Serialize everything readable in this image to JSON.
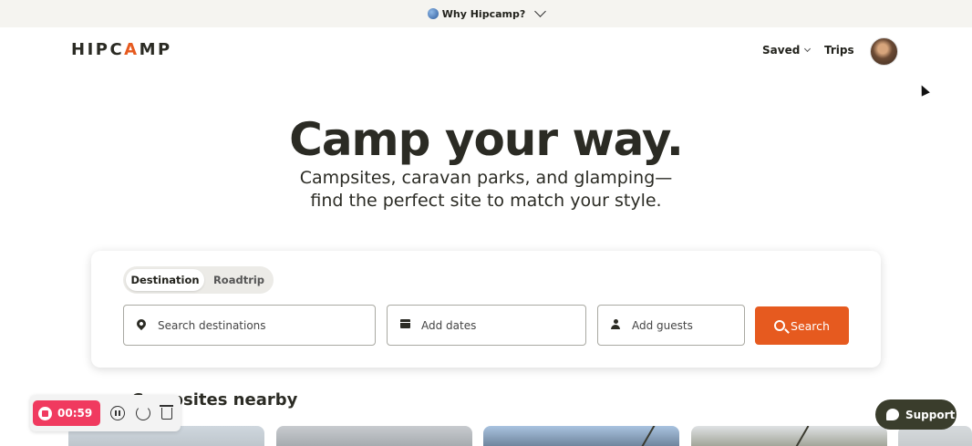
{
  "topbar": {
    "label": "Why Hipcamp?",
    "icon": "globe-icon"
  },
  "header": {
    "logo": "HIPCAMP",
    "nav_saved": "Saved",
    "nav_trips": "Trips"
  },
  "hero": {
    "title": "Camp your way.",
    "subtitle": "Campsites, caravan parks, and glamping—find the perfect site to match your style."
  },
  "search": {
    "tabs": [
      "Destination",
      "Roadtrip"
    ],
    "active_tab": "Destination",
    "destination_placeholder": "Search destinations",
    "dates_placeholder": "Add dates",
    "guests_placeholder": "Add guests",
    "button_label": "Search"
  },
  "section": {
    "title": "Campsites nearby"
  },
  "recorder": {
    "time": "00:59"
  },
  "support": {
    "label": "Support"
  },
  "colors": {
    "accent": "#e65a1f",
    "recorder": "#f03a5f",
    "support_bg": "#3a3d2c"
  }
}
